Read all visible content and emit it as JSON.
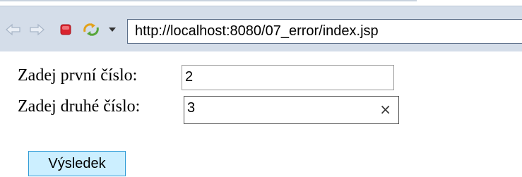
{
  "browser": {
    "url": "http://localhost:8080/07_error/index.jsp",
    "icons": {
      "back": "back-arrow-icon",
      "forward": "forward-arrow-icon",
      "stop": "stop-icon",
      "refresh": "refresh-icon",
      "dropdown": "dropdown-arrow-icon"
    }
  },
  "form": {
    "first_label": "Zadej první číslo:",
    "first_value": "2",
    "second_label": "Zadej druhé číslo:",
    "second_value": "3",
    "clear_symbol": "×",
    "submit_label": "Výsledek"
  },
  "colors": {
    "toolbar_bg": "#d4dde9",
    "button_bg": "#ccefff",
    "button_border": "#2d9ad6",
    "stop_red": "#d9232e"
  }
}
